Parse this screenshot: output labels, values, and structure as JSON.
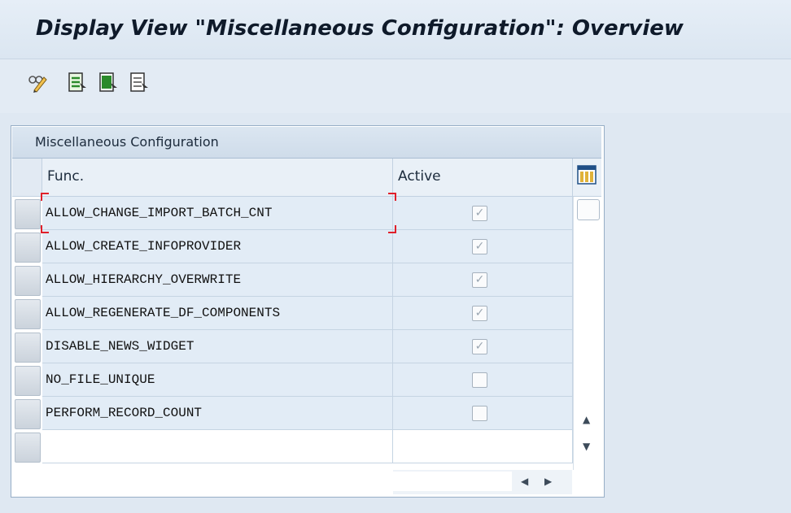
{
  "window": {
    "title": "Display View \"Miscellaneous Configuration\": Overview"
  },
  "toolbar": {
    "buttons": [
      {
        "icon": "display-change-icon"
      },
      {
        "icon": "select-all-icon"
      },
      {
        "icon": "select-block-icon"
      },
      {
        "icon": "deselect-all-icon"
      }
    ]
  },
  "table": {
    "title": "Miscellaneous Configuration",
    "columns": {
      "func": "Func.",
      "active": "Active"
    },
    "rows": [
      {
        "func": "ALLOW_CHANGE_IMPORT_BATCH_CNT",
        "active": true
      },
      {
        "func": "ALLOW_CREATE_INFOPROVIDER",
        "active": true
      },
      {
        "func": "ALLOW_HIERARCHY_OVERWRITE",
        "active": true
      },
      {
        "func": "ALLOW_REGENERATE_DF_COMPONENTS",
        "active": true
      },
      {
        "func": "DISABLE_NEWS_WIDGET",
        "active": true
      },
      {
        "func": "NO_FILE_UNIQUE",
        "active": false
      },
      {
        "func": "PERFORM_RECORD_COUNT",
        "active": false
      }
    ],
    "check_glyph": "✓"
  },
  "colors": {
    "title_text": "#0f1a2a",
    "row_bg": "#e2ecf6",
    "focus": "#e0202a"
  }
}
